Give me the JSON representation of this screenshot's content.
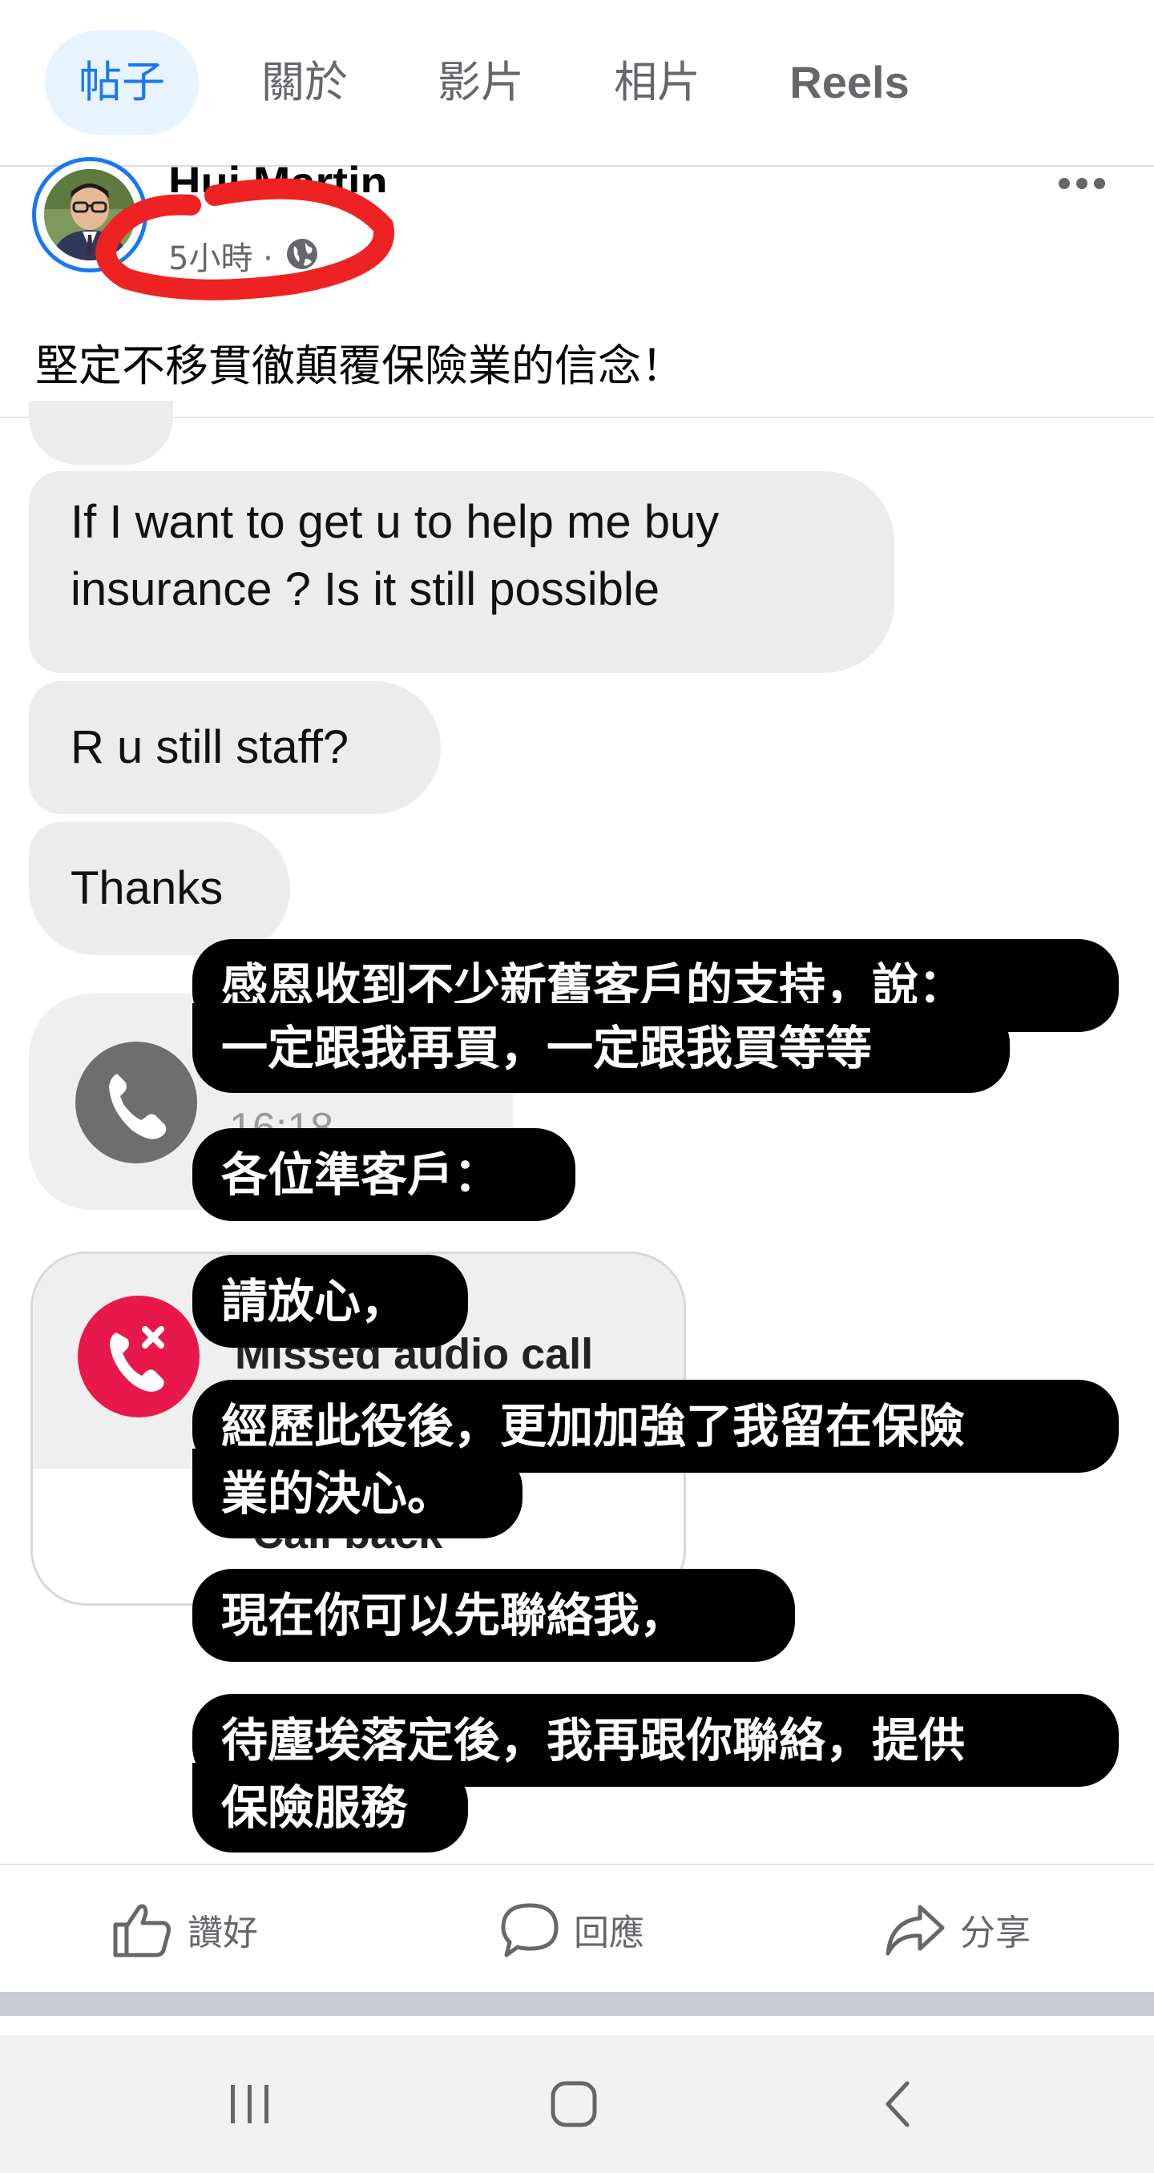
{
  "tabs": [
    "帖子",
    "關於",
    "影片",
    "相片",
    "Reels"
  ],
  "post": {
    "author": "Hui Martin",
    "time": "5小時 ·",
    "text": "堅定不移貫徹顛覆保險業的信念！"
  },
  "chat": {
    "messages": [
      "If I want to get u to help me buy insurance ? Is it still possible",
      "R u still staff?",
      "Thanks"
    ],
    "call_time": "16:18",
    "missed_label": "Missed audio call",
    "call_back": "Call back"
  },
  "captions": [
    "感恩收到不少新舊客戶的支持，說：",
    "一定跟我再買，一定跟我買等等",
    "各位準客戶：",
    "請放心，",
    "經歷此役後，更加加強了我留在保險",
    "業的決心。",
    "現在你可以先聯絡我，",
    "待塵埃落定後，我再跟你聯絡，提供",
    "保險服務"
  ],
  "actions": {
    "like": "讚好",
    "comment": "回應",
    "share": "分享"
  },
  "colors": {
    "accent": "#1877f2",
    "missed_red": "#e8194a",
    "call_grey": "#6e6e6e",
    "annotation_red": "#ee2222"
  }
}
